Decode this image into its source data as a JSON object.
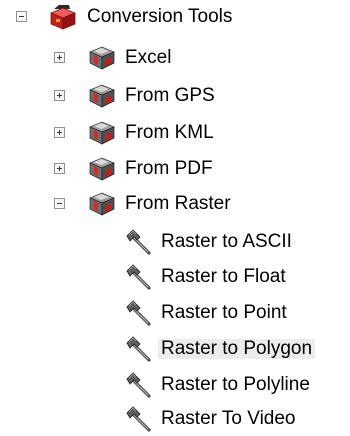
{
  "tree": {
    "root": {
      "label": "Conversion Tools",
      "expanded": true,
      "icon": "red-toolbox-icon"
    },
    "toolsets": [
      {
        "label": "Excel",
        "expanded": false,
        "icon": "toolset-icon"
      },
      {
        "label": "From GPS",
        "expanded": false,
        "icon": "toolset-icon"
      },
      {
        "label": "From KML",
        "expanded": false,
        "icon": "toolset-icon"
      },
      {
        "label": "From PDF",
        "expanded": false,
        "icon": "toolset-icon"
      },
      {
        "label": "From Raster",
        "expanded": true,
        "icon": "toolset-icon"
      }
    ],
    "tools": [
      {
        "label": "Raster to ASCII",
        "icon": "hammer-icon"
      },
      {
        "label": "Raster to Float",
        "icon": "hammer-icon"
      },
      {
        "label": "Raster to Point",
        "icon": "hammer-icon"
      },
      {
        "label": "Raster to Polygon",
        "icon": "hammer-icon",
        "selected": true
      },
      {
        "label": "Raster to Polyline",
        "icon": "hammer-icon"
      },
      {
        "label": "Raster To Video",
        "icon": "hammer-icon"
      }
    ]
  }
}
